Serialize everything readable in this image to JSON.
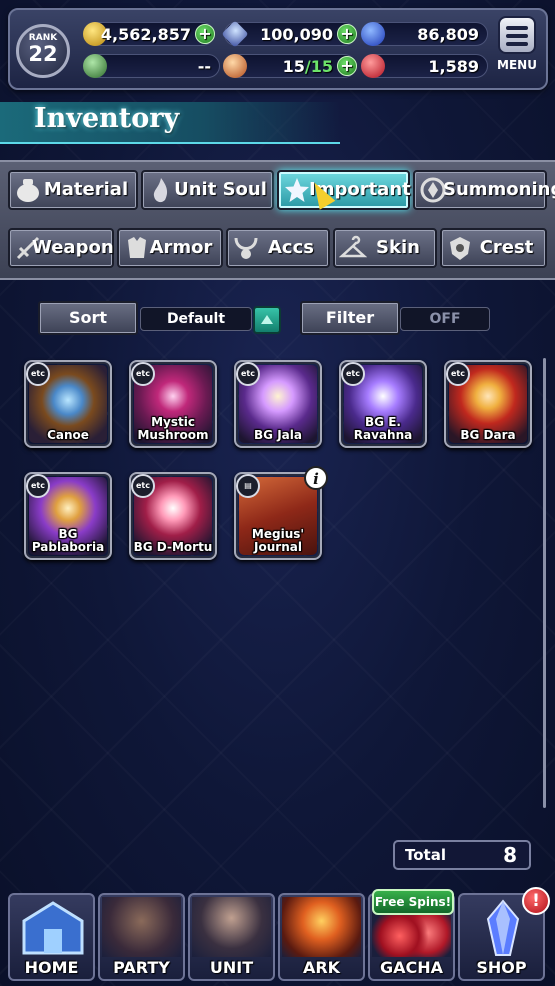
{
  "topbar": {
    "rank_label": "RANK",
    "rank_value": "22",
    "gil": "4,562,857",
    "lapis": "100,090",
    "visiore": "86,809",
    "arena": "--",
    "stamina": "15",
    "stamina_max": "/15",
    "ruby": "1,589",
    "menu_label": "MENU"
  },
  "header": {
    "title": "Inventory"
  },
  "tabs": {
    "material": "Material",
    "unit_soul": "Unit Soul",
    "important": "Important",
    "summoning": "Summoning",
    "weapon": "Weapon",
    "armor": "Armor",
    "accs": "Accs",
    "skin": "Skin",
    "crest": "Crest"
  },
  "controls": {
    "sort_label": "Sort",
    "sort_value": "Default",
    "filter_label": "Filter",
    "filter_value": "OFF"
  },
  "items": [
    {
      "name": "Canoe",
      "tag": "etc"
    },
    {
      "name": "Mystic Mushroom",
      "tag": "etc"
    },
    {
      "name": "BG Jala",
      "tag": "etc"
    },
    {
      "name": "BG E. Ravahna",
      "tag": "etc"
    },
    {
      "name": "BG Dara",
      "tag": "etc"
    },
    {
      "name": "BG Pablaboria",
      "tag": "etc"
    },
    {
      "name": "BG D-Mortu",
      "tag": "etc"
    },
    {
      "name": "Megius' Journal",
      "tag": "",
      "info": "i"
    }
  ],
  "total": {
    "label": "Total",
    "value": "8"
  },
  "nav": {
    "home": "HOME",
    "party": "PARTY",
    "unit": "UNIT",
    "ark": "ARK",
    "gacha": "GACHA",
    "shop": "SHOP",
    "free_spins": "Free Spins!",
    "shop_alert": "!"
  },
  "colors": {
    "accent_cyan": "#54e7f2",
    "plus_green": "#3fbf3e",
    "alert_red": "#d8202a"
  }
}
